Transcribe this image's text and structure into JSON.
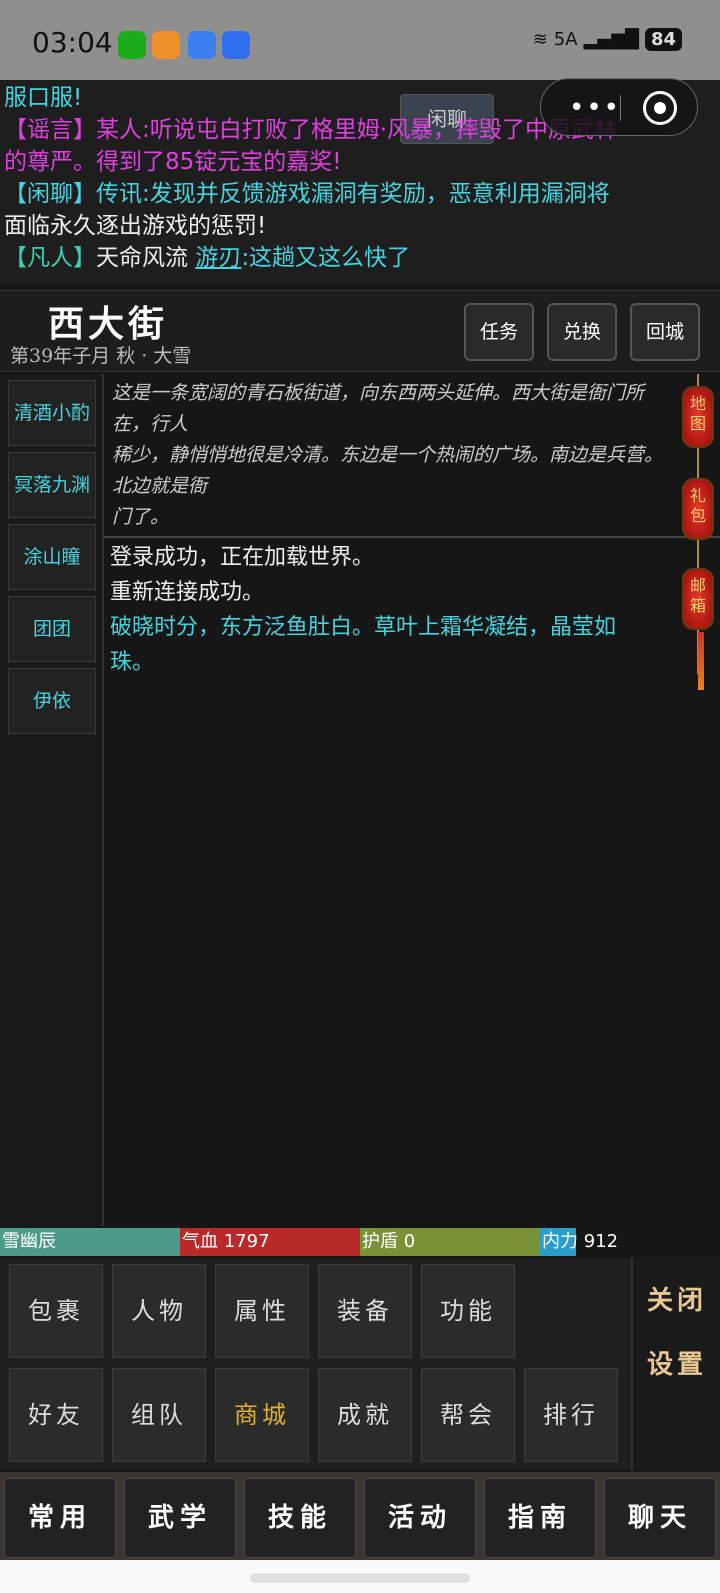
{
  "status_bar": {
    "time": "03:04",
    "network": "5A",
    "battery": "84",
    "apps": [
      "wechat-icon",
      "orange-app-icon",
      "message-icon",
      "voice-icon"
    ]
  },
  "ticker": {
    "line1": "服口服!",
    "line2": "【谣言】某人:听说屯白打败了格里姆·风暴，摔毁了中原武林",
    "line3": "的尊严。得到了85锭元宝的嘉奖!",
    "line4": "【闲聊】传讯:发现并反馈游戏漏洞有奖励，恶意利用漏洞将",
    "line5": "面临永久逐出游戏的惩罚!",
    "line6_prefix": "【凡人】",
    "line6_name": "天命风流",
    "line6_link": "游刃",
    "line6_text": ":这趟又这么快了",
    "chat_tab": "闲聊"
  },
  "location": {
    "name": "西大街",
    "date": "第39年子月 秋 · 大雪",
    "buttons": [
      "任务",
      "兑换",
      "回城"
    ]
  },
  "npcs": [
    "清酒小酌",
    "冥落九渊",
    "涂山瞳",
    "团团",
    "伊依"
  ],
  "description": {
    "line1": "这是一条宽阔的青石板街道，向东西两头延伸。西大街是衙门所",
    "line2": "在，行人",
    "line3": "稀少，静悄悄地很是冷清。东边是一个热闹的广场。南边是兵营。",
    "line4": "北边就是衙",
    "line5": "门了。"
  },
  "log": {
    "line1": "登录成功，正在加载世界。",
    "line2": "重新连接成功。",
    "line3": "破晓时分，东方泛鱼肚白。草叶上霜华凝结，晶莹如",
    "line4": "珠。"
  },
  "lanterns": [
    "地图",
    "礼包",
    "邮箱"
  ],
  "bars": {
    "name": "雪幽辰",
    "hp_label": "气血",
    "hp_value": "1797",
    "shield_label": "护盾",
    "shield_value": "0",
    "mp_label": "内力",
    "mp_value": "912"
  },
  "menu": {
    "row1": [
      "包裹",
      "人物",
      "属性",
      "装备",
      "功能"
    ],
    "row2": [
      "好友",
      "组队",
      "商城",
      "成就",
      "帮会",
      "排行"
    ],
    "close": "关闭",
    "settings": "设置"
  },
  "nav": [
    "常用",
    "武学",
    "技能",
    "活动",
    "指南",
    "聊天"
  ],
  "colors": {
    "accent_cyan": "#44d4e0",
    "rumor_magenta": "#e040e0",
    "shop_gold": "#e0b030",
    "lantern_red": "#c82018"
  }
}
